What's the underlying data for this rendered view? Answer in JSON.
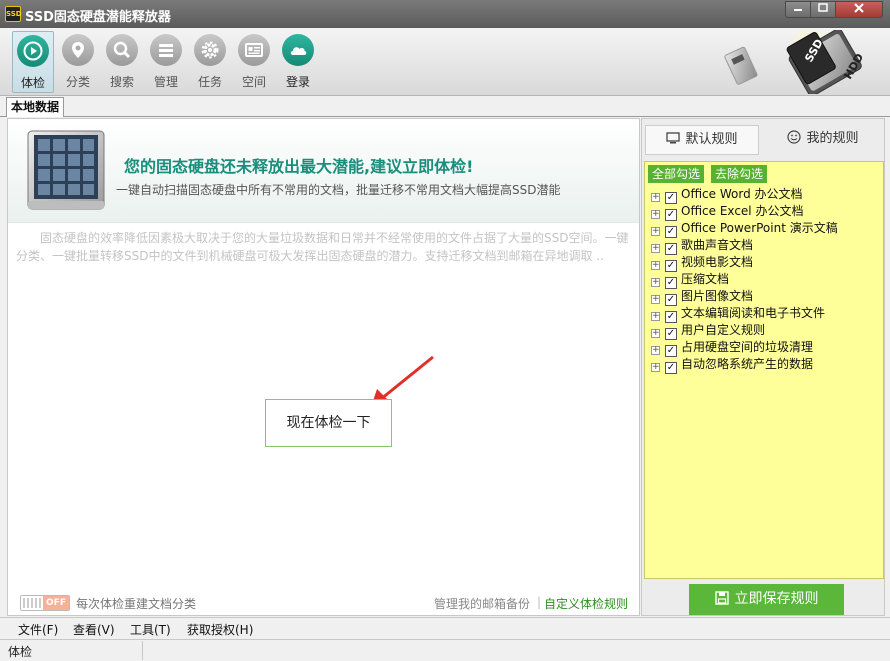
{
  "window": {
    "title": "SSD固态硬盘潜能释放器",
    "app_icon_text": "SSD"
  },
  "toolbar": {
    "items": [
      {
        "label": "体检",
        "icon": "play-icon"
      },
      {
        "label": "分类",
        "icon": "location-pin-icon"
      },
      {
        "label": "搜索",
        "icon": "search-icon"
      },
      {
        "label": "管理",
        "icon": "list-icon"
      },
      {
        "label": "任务",
        "icon": "gear-icon"
      },
      {
        "label": "空间",
        "icon": "id-card-icon"
      },
      {
        "label": "登录",
        "icon": "cloud-icon"
      }
    ],
    "logo_labels": [
      "SSD",
      "HDD"
    ]
  },
  "tabs": {
    "local_data": "本地数据"
  },
  "main": {
    "headline": "您的固态硬盘还未释放出最大潜能,建议立即体检!",
    "subline": "一键自动扫描固态硬盘中所有不常用的文档，批量迁移不常用文档大幅提高SSD潜能",
    "description": "固态硬盘的效率降低因素极大取决于您的大量垃圾数据和日常并不经常使用的文件占据了大量的SSD空间。一键分类、一键批量转移SSD中的文件到机械硬盘可极大发挥出固态硬盘的潜力。支持迁移文档到邮箱在异地调取 ..",
    "check_button": "现在体检一下",
    "toggle_state": "OFF",
    "toggle_label": "每次体检重建文档分类",
    "link_mailbox": "管理我的邮箱备份",
    "link_separator": "|",
    "link_custom": "自定义体检规则"
  },
  "right_panel": {
    "tab_default": "默认规则",
    "tab_mine": "我的规则",
    "select_all": "全部勾选",
    "select_none": "去除勾选",
    "rules": [
      "Office Word 办公文档",
      "Office Excel 办公文档",
      "Office PowerPoint 演示文稿",
      "歌曲声音文档",
      "视频电影文档",
      "压缩文档",
      "图片图像文档",
      "文本编辑阅读和电子书文件",
      "用户自定义规则",
      "占用硬盘空间的垃圾清理",
      "自动忽略系统产生的数据"
    ],
    "expand_glyph": "+",
    "check_glyph": "✓",
    "save_button": "立即保存规则"
  },
  "menubar": {
    "items": [
      "文件(F)",
      "查看(V)",
      "工具(T)",
      "获取授权(H)"
    ]
  },
  "statusbar": {
    "text": "体检"
  },
  "colors": {
    "accent": "#1a8e7c",
    "green_button": "#5bb73a",
    "rules_bg": "#ffff99",
    "title_bar": "#5b5b5b"
  }
}
